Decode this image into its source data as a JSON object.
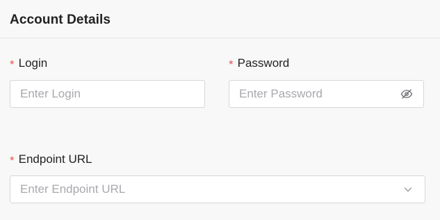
{
  "section": {
    "title": "Account Details"
  },
  "fields": {
    "login": {
      "required_mark": "*",
      "label": "Login",
      "value": "",
      "placeholder": "Enter Login"
    },
    "password": {
      "required_mark": "*",
      "label": "Password",
      "value": "",
      "placeholder": "Enter Password",
      "visibility_icon": "eye-slash-icon"
    },
    "endpoint_url": {
      "required_mark": "*",
      "label": "Endpoint URL",
      "value": "",
      "placeholder": "Enter Endpoint URL",
      "dropdown_icon": "chevron-down-icon"
    }
  },
  "colors": {
    "required": "#e05a4f",
    "border": "#d6d6da",
    "placeholder": "#a8a8ae",
    "background": "#f8f8f9"
  }
}
